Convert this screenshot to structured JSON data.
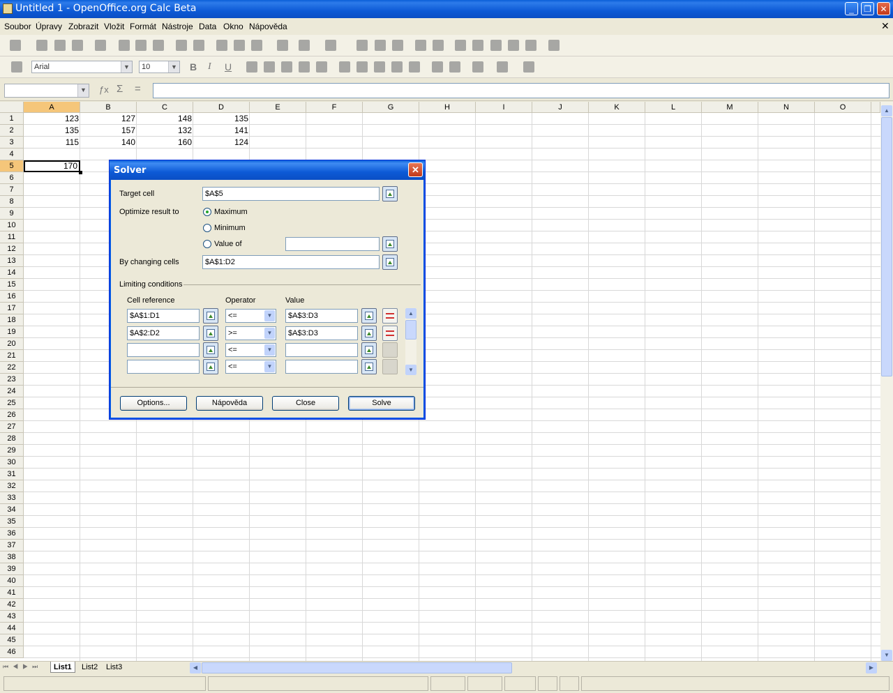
{
  "window": {
    "title": "Untitled 1 - OpenOffice.org Calc Beta"
  },
  "menu": [
    "Soubor",
    "Úpravy",
    "Zobrazit",
    "Vložit",
    "Formát",
    "Nástroje",
    "Data",
    "Okno",
    "Nápověda"
  ],
  "format_toolbar": {
    "font": "Arial",
    "size": "10",
    "bold": "B",
    "italic": "I",
    "underline": "U"
  },
  "formula_bar": {
    "name_box": "",
    "input": ""
  },
  "columns": [
    "A",
    "B",
    "C",
    "D",
    "E",
    "F",
    "G",
    "H",
    "I",
    "J",
    "K",
    "L",
    "M",
    "N",
    "O"
  ],
  "rows": [
    "1",
    "2",
    "3",
    "4",
    "5",
    "6",
    "7",
    "8",
    "9",
    "10",
    "11",
    "12",
    "13",
    "14",
    "15",
    "16",
    "17",
    "18",
    "19",
    "20",
    "21",
    "22",
    "23",
    "24",
    "25",
    "26",
    "27",
    "28",
    "29",
    "30",
    "31",
    "32",
    "33",
    "34",
    "35",
    "36",
    "37",
    "38",
    "39",
    "40",
    "41",
    "42",
    "43",
    "44",
    "45",
    "46"
  ],
  "cells": {
    "r1": [
      "123",
      "127",
      "148",
      "135"
    ],
    "r2": [
      "135",
      "157",
      "132",
      "141"
    ],
    "r3": [
      "115",
      "140",
      "160",
      "124"
    ],
    "a5": "170"
  },
  "sheet_tabs": [
    "List1",
    "List2",
    "List3"
  ],
  "dialog": {
    "title": "Solver",
    "target_label": "Target cell",
    "target_value": "$A$5",
    "optimize_label": "Optimize result to",
    "opt_max": "Maximum",
    "opt_min": "Minimum",
    "opt_value": "Value of",
    "value_of": "",
    "changing_label": "By changing cells",
    "changing_value": "$A$1:D2",
    "limits_label": "Limiting conditions",
    "col_ref": "Cell reference",
    "col_op": "Operator",
    "col_val": "Value",
    "conditions": [
      {
        "ref": "$A$1:D1",
        "op": "<=",
        "val": "$A$3:D3"
      },
      {
        "ref": "$A$2:D2",
        "op": ">=",
        "val": "$A$3:D3"
      },
      {
        "ref": "",
        "op": "<=",
        "val": ""
      },
      {
        "ref": "",
        "op": "<=",
        "val": ""
      }
    ],
    "btn_options": "Options...",
    "btn_help": "Nápověda",
    "btn_close": "Close",
    "btn_solve": "Solve"
  }
}
